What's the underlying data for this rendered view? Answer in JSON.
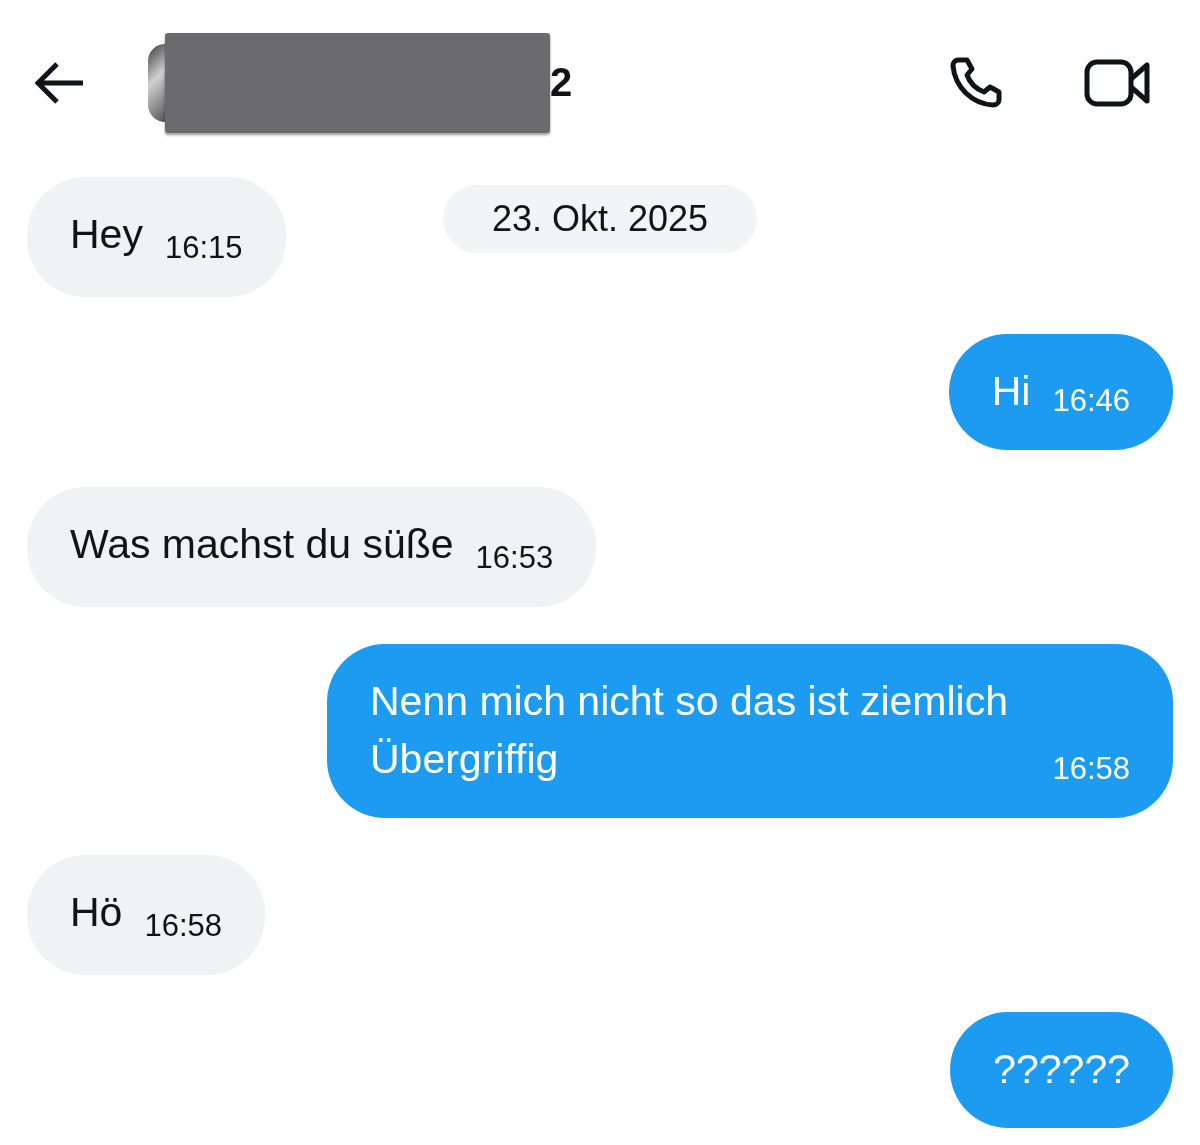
{
  "header": {
    "name_visible_part": "2",
    "redacted": true
  },
  "date_label": "23. Okt. 2025",
  "messages": [
    {
      "kind": "incoming",
      "text": "Hey",
      "time": "16:15"
    },
    {
      "kind": "outgoing",
      "text": "Hi",
      "time": "16:46"
    },
    {
      "kind": "incoming",
      "text": "Was machst du süße",
      "time": "16:53"
    },
    {
      "kind": "outgoing",
      "text": "Nenn mich nicht so das ist ziemlich Übergriffig",
      "time": "16:58"
    },
    {
      "kind": "incoming",
      "text": "Hö",
      "time": "16:58"
    },
    {
      "kind": "outgoing",
      "text": "??????"
    }
  ]
}
